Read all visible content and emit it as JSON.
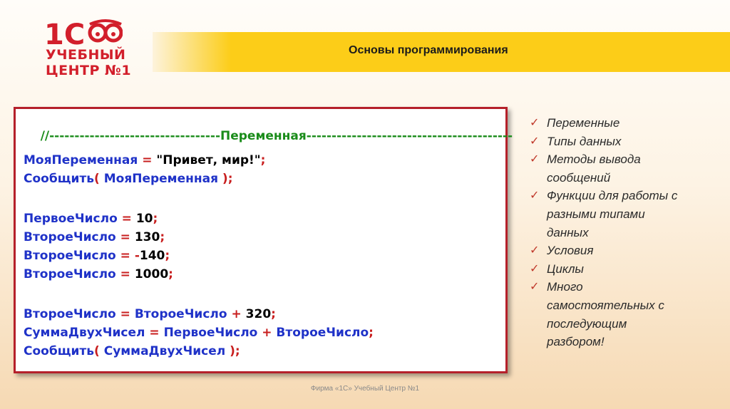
{
  "logo": {
    "mark_text": "1C",
    "line1": "УЧЕБНЫЙ",
    "line2": "ЦЕНТР №1"
  },
  "header": {
    "title": "Основы программирования"
  },
  "code": {
    "comment_line": "//----------------------------------Переменная-----------------------------------------",
    "line_var_name": "МояПеременная",
    "line_var_eq": " = ",
    "line_var_value": "\"Привет, мир!\"",
    "semicolon": ";",
    "msg_func": "Сообщить",
    "paren_open": "( ",
    "msg_arg": "МояПеременная",
    "paren_close": " );",
    "first_num_name": "ПервоеЧисло",
    "eq": " = ",
    "first_num_value": "10",
    "second_num_name": "ВтороеЧисло",
    "second_val_1": "130",
    "minus": "-",
    "second_val_2": "140",
    "second_val_3": "1000",
    "plus": " + ",
    "add_value": "320",
    "sum_name": "СуммаДвухЧисел",
    "sum_func_arg": "СуммаДвухЧисел"
  },
  "bullets": [
    "Переменные",
    "Типы данных",
    "Методы вывода",
    "сообщений",
    "Функции для работы с",
    "разными типами",
    "данных",
    "Условия",
    "Циклы",
    "Много",
    "самостоятельных с",
    "последующим",
    "разбором!"
  ],
  "check_icon": "✓",
  "footer": "Фирма «1С» Учебный Центр №1",
  "colors": {
    "accent": "#fccd18",
    "brand_red": "#d21f2b",
    "code_blue": "#1f32c8",
    "code_green": "#1a8c1a",
    "code_red": "#c81e1e"
  }
}
